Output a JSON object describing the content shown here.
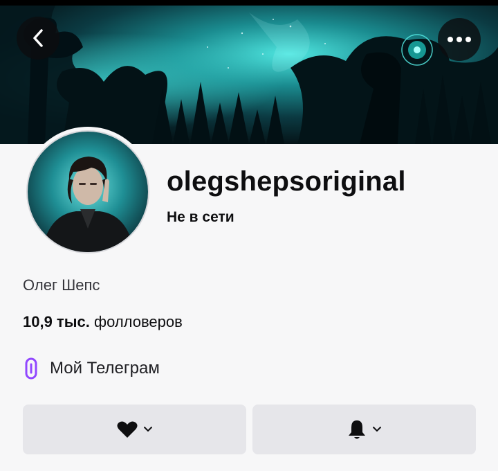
{
  "header": {
    "back_icon": "chevron-left-icon",
    "more_icon": "more-dots-icon"
  },
  "profile": {
    "username": "olegshepsoriginal",
    "status": "Не в сети",
    "display_name": "Олег Шепс",
    "followers_count": "10,9 тыс.",
    "followers_label": "фолловеров"
  },
  "links": [
    {
      "label": "Мой Телеграм",
      "icon": "link-icon",
      "icon_color": "#9147ff"
    }
  ],
  "actions": {
    "follow_icon": "heart-icon",
    "notify_icon": "bell-icon"
  },
  "colors": {
    "accent": "#9147ff",
    "banner_glow": "#2fd3cf",
    "button_bg": "#e6e6ea"
  }
}
